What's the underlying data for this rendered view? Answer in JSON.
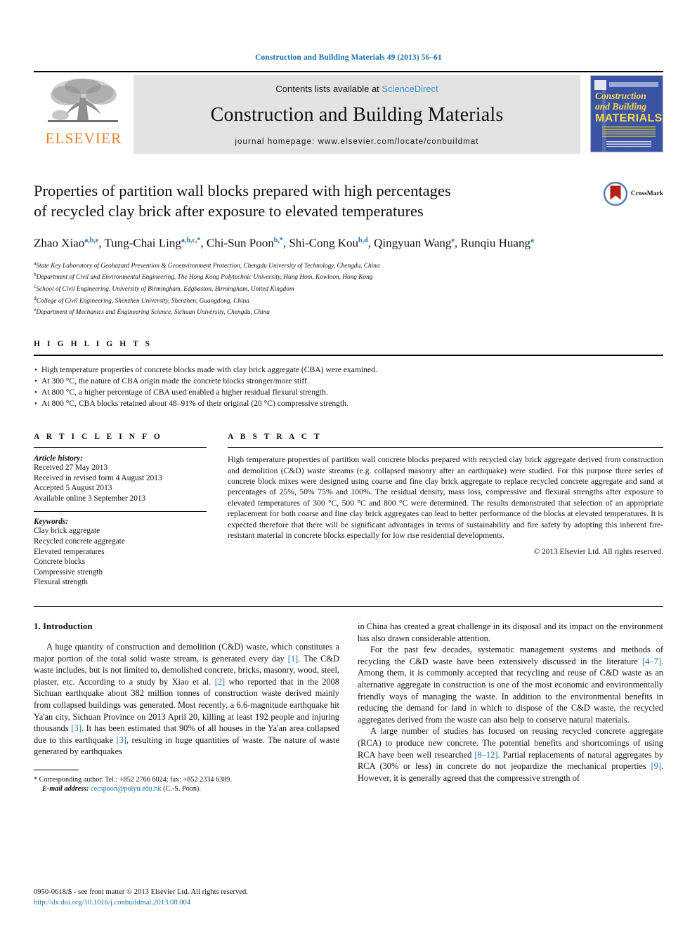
{
  "running_head": "Construction and Building Materials 49 (2013) 56–61",
  "masthead": {
    "publisher": "ELSEVIER",
    "contents_prefix": "Contents lists available at",
    "contents_link": "ScienceDirect",
    "journal_title": "Construction and Building Materials",
    "homepage": "journal homepage: www.elsevier.com/locate/conbuildmat",
    "cover": {
      "line1": "Construction",
      "line2": "and Building",
      "line3": "MATERIALS"
    }
  },
  "article": {
    "title_line1": "Properties of partition wall blocks prepared with high percentages",
    "title_line2": "of recycled clay brick after exposure to elevated temperatures",
    "crossmark_label": "CrossMark",
    "authors": [
      {
        "name": "Zhao Xiao",
        "sup": "a,b,e",
        "sep": ", "
      },
      {
        "name": "Tung-Chai Ling",
        "sup": "a,b,c,*",
        "sep": ", "
      },
      {
        "name": "Chi-Sun Poon",
        "sup": "b,*",
        "sep": ", "
      },
      {
        "name": "Shi-Cong Kou",
        "sup": "b,d",
        "sep": ", "
      },
      {
        "name": "Qingyuan Wang",
        "sup": "e",
        "sep": ", "
      },
      {
        "name": "Runqiu Huang",
        "sup": "a",
        "sep": ""
      }
    ],
    "affiliations": [
      {
        "mark": "a",
        "text": "State Key Laboratory of Geohazard Prevention & Geoenvironment Protection, Chengdu University of Technology, Chengdu, China"
      },
      {
        "mark": "b",
        "text": "Department of Civil and Environmental Engineering, The Hong Kong Polytechnic University, Hung Hom, Kowloon, Hong Kong"
      },
      {
        "mark": "c",
        "text": "School of Civil Engineering, University of Birmingham, Edgbaston, Birmingham, United Kingdom"
      },
      {
        "mark": "d",
        "text": "College of Civil Engineering, Shenzhen University, Shenzhen, Guangdong, China"
      },
      {
        "mark": "e",
        "text": "Department of Mechanics and Engineering Science, Sichuan University, Chengdu, China"
      }
    ]
  },
  "highlights": {
    "heading": "H I G H L I G H T S",
    "items": [
      "High temperature properties of concrete blocks made with clay brick aggregate (CBA) were examined.",
      "At 300 °C, the nature of CBA origin made the concrete blocks stronger/more stiff.",
      "At 800 °C, a higher percentage of CBA used enabled a higher residual flexural strength.",
      "At 800 °C, CBA blocks retained about 48–91% of their original (20 °C) compressive strength."
    ]
  },
  "article_info": {
    "heading": "A R T I C L E    I N F O",
    "history_label": "Article history:",
    "history": [
      "Received 27 May 2013",
      "Received in revised form 4 August 2013",
      "Accepted 5 August 2013",
      "Available online 3 September 2013"
    ],
    "keywords_label": "Keywords:",
    "keywords": [
      "Clay brick aggregate",
      "Recycled concrete aggregate",
      "Elevated temperatures",
      "Concrete blocks",
      "Compressive strength",
      "Flexural strength"
    ]
  },
  "abstract": {
    "heading": "A B S T R A C T",
    "text": "High temperature properties of partition wall concrete blocks prepared with recycled clay brick aggregate derived from construction and demolition (C&D) waste streams (e.g. collapsed masonry after an earthquake) were studied. For this purpose three series of concrete block mixes were designed using coarse and fine clay brick aggregate to replace recycled concrete aggregate and sand at percentages of 25%, 50% 75% and 100%. The residual density, mass loss, compressive and flexural strengths after exposure to elevated temperatures of 300 °C, 500 °C and 800 °C were determined. The results demonstrated that selection of an appropriate replacement for both coarse and fine clay brick aggregates can lead to better performance of the blocks at elevated temperatures. It is expected therefore that there will be significant advantages in terms of sustainability and fire safety by adopting this inherent fire-resistant material in concrete blocks especially for low rise residential developments.",
    "copyright": "© 2013 Elsevier Ltd. All rights reserved."
  },
  "introduction": {
    "number_title": "1. Introduction",
    "left_para1_a": "A huge quantity of construction and demolition (C&D) waste, which constitutes a major portion of the total solid waste stream, is generated every day ",
    "ref1": "[1]",
    "left_para1_b": ". The C&D waste includes, but is not limited to, demolished concrete, bricks, masonry, wood, steel, plaster, etc. According to a study by Xiao et al. ",
    "ref2": "[2]",
    "left_para1_c": " who reported that in the 2008 Sichuan earthquake about 382 million tonnes of construction waste derived mainly from collapsed buildings was generated. Most recently, a 6.6-magnitude earthquake hit Ya'an city, Sichuan Province on 2013 April 20, killing at least 192 people and injuring thousands ",
    "ref3a": "[3]",
    "left_para1_d": ". It has been estimated that 90% of all houses in the Ya'an area collapsed due to this earthquake ",
    "ref3b": "[3]",
    "left_para1_e": ", resulting in huge quantities of waste. The nature of waste generated by earthquakes",
    "right_para_cont": "in China has created a great challenge in its disposal and its impact on the environment has also drawn considerable attention.",
    "right_para2_a": "For the past few decades, systematic management systems and methods of recycling the C&D waste have been extensively discussed in the literature ",
    "ref47": "[4–7]",
    "right_para2_b": ". Among them, it is commonly accepted that recycling and reuse of C&D waste as an alternative aggregate in construction is one of the most economic and environmentally friendly ways of managing the waste. In addition to the environmental benefits in reducing the demand for land in which to dispose of the C&D waste, the recycled aggregates derived from the waste can also help to conserve natural materials.",
    "right_para3_a": "A large number of studies has focused on reusing recycled concrete aggregate (RCA) to produce new concrete. The potential benefits and shortcomings of using RCA have been well researched ",
    "ref812": "[8–12]",
    "right_para3_b": ". Partial replacements of natural aggregates by RCA (30% or less) in concrete do not jeopardize the mechanical properties ",
    "ref9": "[9]",
    "right_para3_c": ". However, it is generally agreed that the compressive strength of"
  },
  "footnotes": {
    "corresponding": "* Corresponding author. Tel.: +852 2766 6024; fax: +852 2334 6389.",
    "email_label": "E-mail address:",
    "email": "cecspoon@polyu.edu.hk",
    "email_suffix": " (C.-S. Poon)."
  },
  "footer": {
    "issn_line": "0950-0618/$ - see front matter © 2013 Elsevier Ltd. All rights reserved.",
    "doi": "http://dx.doi.org/10.1016/j.conbuildmat.2013.08.004"
  },
  "colors": {
    "link": "#1a6ea8",
    "sciencedirect": "#3f8ed0",
    "elsevier_orange": "#ED7D22",
    "cover_blue": "#3a53a4",
    "cover_yellow": "#ffd94a"
  }
}
